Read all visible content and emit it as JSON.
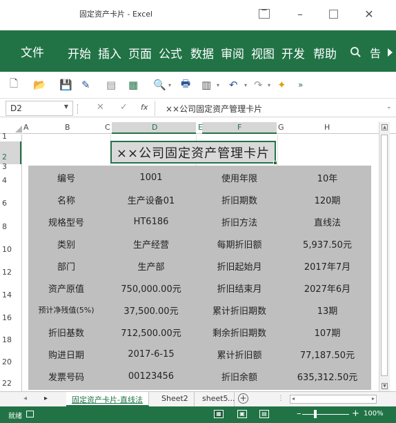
{
  "window": {
    "title": "固定资产卡片 - Excel",
    "minimize_glyph": "–",
    "close_glyph": "✕"
  },
  "menu": {
    "file": "文件",
    "tabs": [
      "开始",
      "插入",
      "页面",
      "公式",
      "数据",
      "审阅",
      "视图",
      "开发",
      "帮助"
    ],
    "tell_me": "告"
  },
  "formula_bar": {
    "name_box": "D2",
    "content": "××公司固定资产管理卡片",
    "fx": "fx"
  },
  "columns": [
    "A",
    "B",
    "C",
    "D",
    "E",
    "F",
    "G",
    "H"
  ],
  "rows": [
    "1",
    "2",
    "3",
    "4",
    "6",
    "8",
    "10",
    "12",
    "14",
    "16",
    "18",
    "20",
    "22"
  ],
  "sheet_title": "××公司固定资产管理卡片",
  "table": [
    [
      "编号",
      "1001",
      "使用年限",
      "10年"
    ],
    [
      "名称",
      "生产设备01",
      "折旧期数",
      "120期"
    ],
    [
      "规格型号",
      "HT6186",
      "折旧方法",
      "直线法"
    ],
    [
      "类别",
      "生产经营",
      "每期折旧额",
      "5,937.50元"
    ],
    [
      "部门",
      "生产部",
      "折旧起始月",
      "2017年7月"
    ],
    [
      "资产原值",
      "750,000.00元",
      "折旧结束月",
      "2027年6月"
    ],
    [
      "预计净残值(5%)",
      "37,500.00元",
      "累计折旧期数",
      "13期"
    ],
    [
      "折旧基数",
      "712,500.00元",
      "剩余折旧期数",
      "107期"
    ],
    [
      "购进日期",
      "2017-6-15",
      "累计折旧额",
      "77,187.50元"
    ],
    [
      "发票号码",
      "00123456",
      "折旧余额",
      "635,312.50元"
    ]
  ],
  "sheet_tabs": [
    "固定资产卡片-直线法",
    "Sheet2",
    "sheet5",
    "..."
  ],
  "status": {
    "ready": "就绪",
    "zoom": "100%"
  },
  "colors": {
    "excel_green": "#217346",
    "table_gray": "#bfbfbf"
  }
}
